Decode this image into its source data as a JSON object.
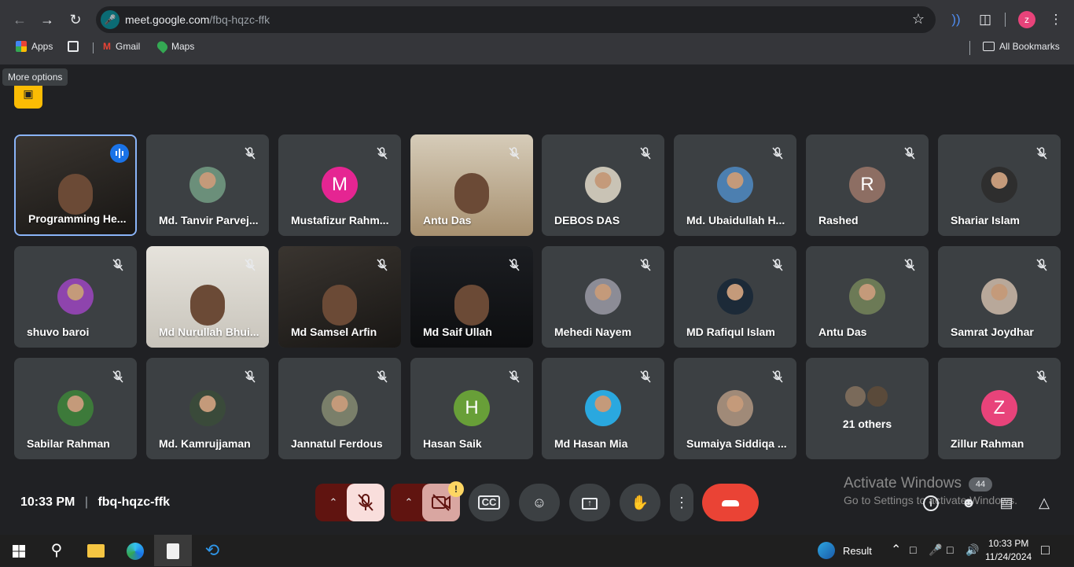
{
  "browser": {
    "url_host": "meet.google.com",
    "url_path": "/fbq-hqzc-ffk",
    "profile_initial": "z",
    "bookmarks": [
      {
        "label": "Apps"
      },
      {
        "label": "Gmail"
      },
      {
        "label": "Maps"
      }
    ],
    "all_bookmarks": "All Bookmarks"
  },
  "tooltip": "More options",
  "participants": [
    {
      "name": "Programming He...",
      "type": "video",
      "active": true
    },
    {
      "name": "Md. Tanvir Parvej...",
      "type": "photo",
      "color": "#6b8f7a"
    },
    {
      "name": "Mustafizur Rahm...",
      "type": "initial",
      "initial": "M",
      "color": "#e52592"
    },
    {
      "name": "Antu Das",
      "type": "video"
    },
    {
      "name": "DEBOS DAS",
      "type": "photo",
      "color": "#c9c3b5"
    },
    {
      "name": "Md. Ubaidullah H...",
      "type": "photo",
      "color": "#4c7fb0"
    },
    {
      "name": "Rashed",
      "type": "initial",
      "initial": "R",
      "color": "#8d6e63"
    },
    {
      "name": "Shariar Islam",
      "type": "photo",
      "color": "#2e2e2e"
    },
    {
      "name": "shuvo baroi",
      "type": "photo",
      "color": "#8e44ad"
    },
    {
      "name": "Md Nurullah Bhui...",
      "type": "video"
    },
    {
      "name": "Md Samsel Arfin",
      "type": "video"
    },
    {
      "name": "Md Saif Ullah",
      "type": "video"
    },
    {
      "name": "Mehedi Nayem",
      "type": "photo",
      "color": "#8c8c96"
    },
    {
      "name": "MD Rafiqul Islam",
      "type": "photo",
      "color": "#1c2a38"
    },
    {
      "name": "Antu Das",
      "type": "photo",
      "color": "#6c7a56"
    },
    {
      "name": "Samrat Joydhar",
      "type": "photo",
      "color": "#b8a89a"
    },
    {
      "name": "Sabilar Rahman",
      "type": "photo",
      "color": "#3d7a3a"
    },
    {
      "name": "Md. Kamrujjaman",
      "type": "photo",
      "color": "#3a4a3a"
    },
    {
      "name": "Jannatul Ferdous",
      "type": "photo",
      "color": "#7a7f6a"
    },
    {
      "name": "Hasan Saik",
      "type": "initial",
      "initial": "H",
      "color": "#689f38"
    },
    {
      "name": "Md Hasan Mia",
      "type": "photo",
      "color": "#2aa8df"
    },
    {
      "name": "Sumaiya Siddiqa ...",
      "type": "photo",
      "color": "#a08a78"
    },
    {
      "name": "21 others",
      "type": "others"
    },
    {
      "name": "Zillur Rahman",
      "type": "initial",
      "initial": "Z",
      "color": "#e8437a"
    }
  ],
  "meeting": {
    "time": "10:33 PM",
    "separator": "|",
    "code": "fbq-hqzc-ffk"
  },
  "controls": {
    "warning": "!"
  },
  "watermark": {
    "title": "Activate Windows",
    "subtitle": "Go to Settings to activate Windows.",
    "badge": "44"
  },
  "taskbar": {
    "weather_label": "Result",
    "clock_time": "10:33 PM",
    "clock_date": "11/24/2024"
  }
}
